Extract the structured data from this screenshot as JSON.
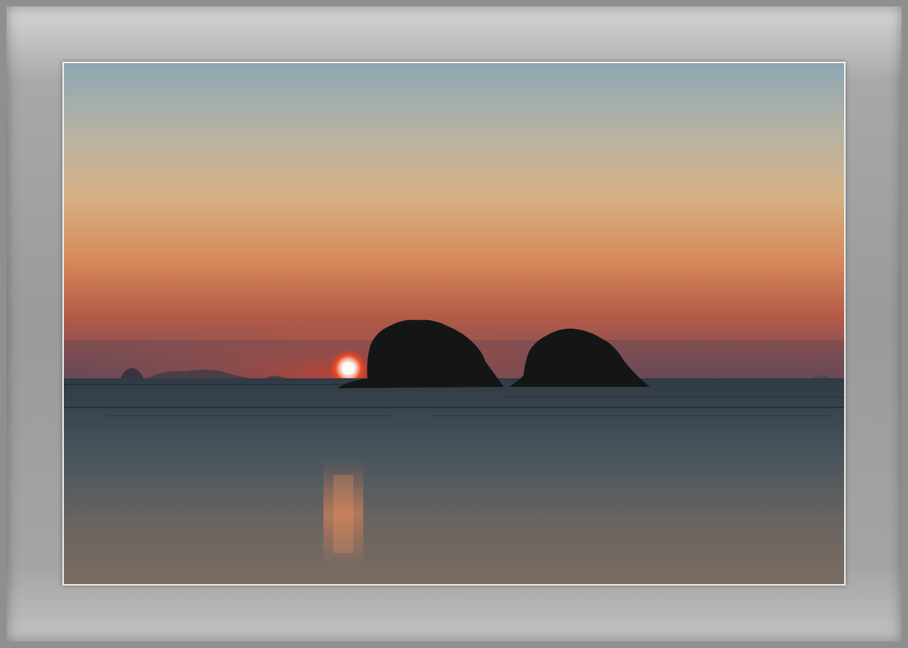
{
  "scene": {
    "sky_top_color": "#8fa6b2",
    "sky_mid_color": "#d9b489",
    "sky_horizon_color": "#d9694a",
    "sea_color": "#3f4a52",
    "sun_color": "#fff4e8",
    "frame_color": "#9b9b9b",
    "sun_icon": "sun-disc",
    "island_icons": [
      "island-left",
      "island-right"
    ]
  }
}
